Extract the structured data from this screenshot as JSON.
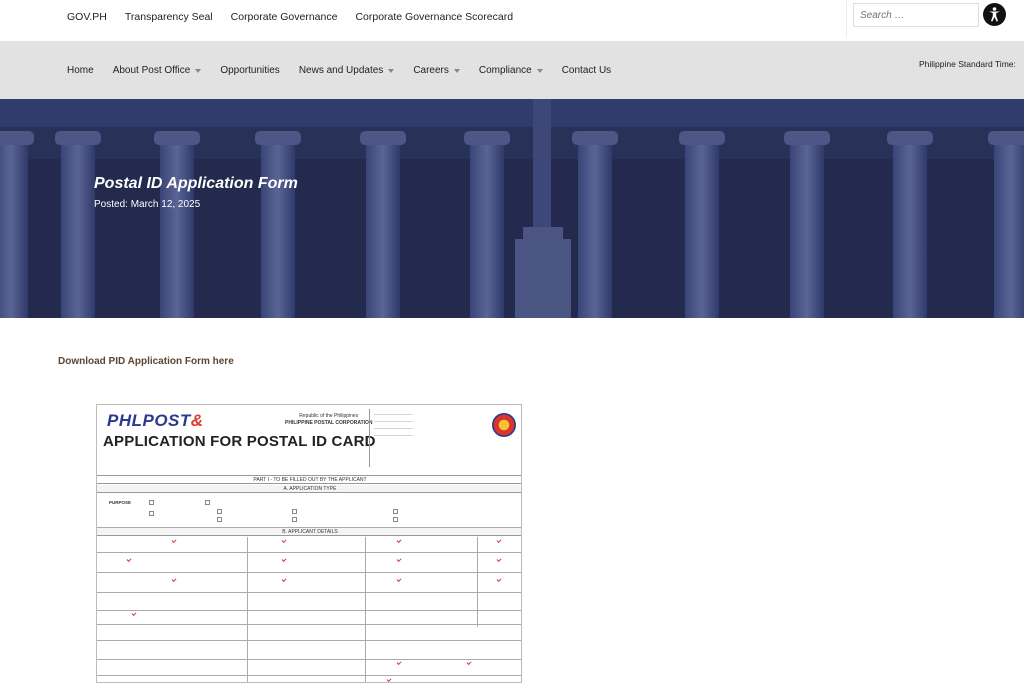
{
  "topbar": {
    "links": [
      "GOV.PH",
      "Transparency Seal",
      "Corporate Governance",
      "Corporate Governance Scorecard"
    ],
    "search_placeholder": "Search …",
    "accessibility_icon": "accessibility-icon"
  },
  "navbar": {
    "items": [
      {
        "label": "Home",
        "dropdown": false
      },
      {
        "label": "About Post Office",
        "dropdown": true
      },
      {
        "label": "Opportunities",
        "dropdown": false
      },
      {
        "label": "News and Updates",
        "dropdown": true
      },
      {
        "label": "Careers",
        "dropdown": true
      },
      {
        "label": "Compliance",
        "dropdown": true
      },
      {
        "label": "Contact Us",
        "dropdown": false
      }
    ],
    "time_label": "Philippine Standard Time:"
  },
  "hero": {
    "title": "Postal ID Application Form",
    "posted": "Posted: March 12, 2025"
  },
  "content": {
    "download_link": "Download PID Application Form here"
  },
  "form_image": {
    "logo_main": "PHLPOST",
    "logo_accent": "&",
    "title": "APPLICATION FOR POSTAL ID CARD",
    "gov_line1": "Republic of the Philippines",
    "gov_line2": "PHILIPPINE POSTAL CORPORATION",
    "part_label": "PART I - TO BE FILLED OUT BY THE APPLICANT",
    "section_a": "A. APPLICATION TYPE",
    "section_b": "B. APPLICANT DETAILS",
    "purpose_label": "PURPOSE"
  },
  "colors": {
    "navbar_bg": "#e2e2e2",
    "hero_bg": "#2a3360",
    "download_link": "#5a4632"
  }
}
